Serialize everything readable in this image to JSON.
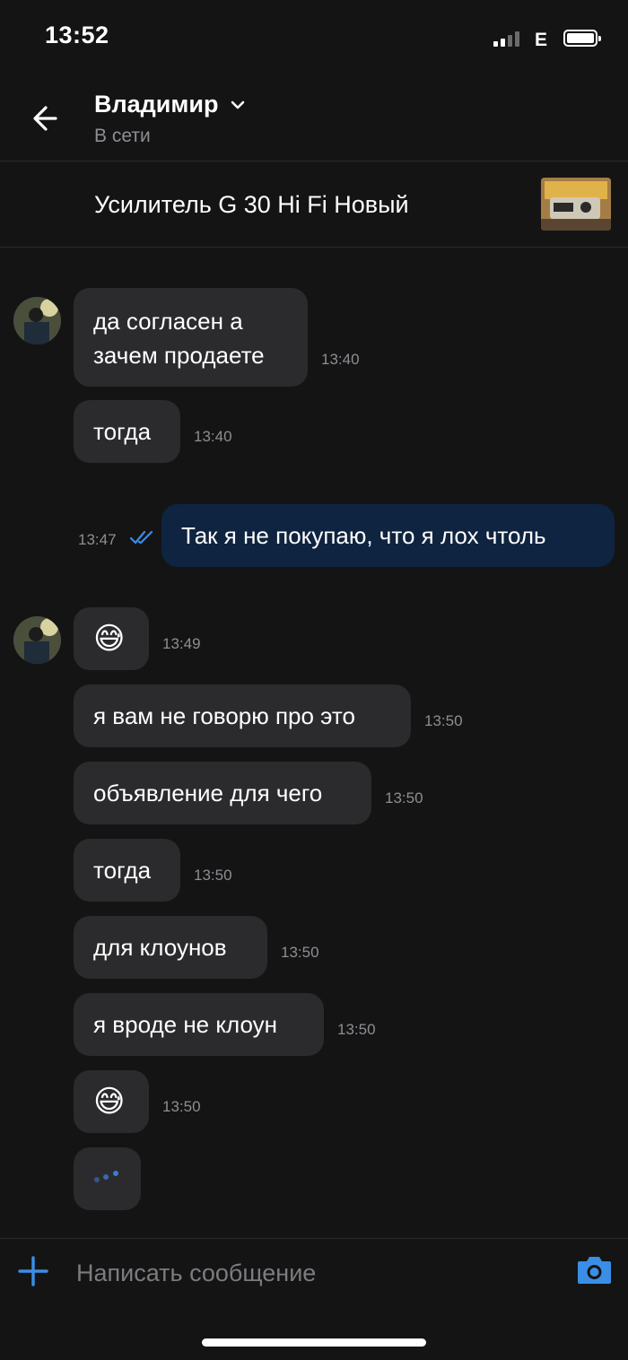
{
  "status_bar": {
    "time": "13:52",
    "network": "E"
  },
  "header": {
    "name": "Владимир",
    "status": "В сети"
  },
  "listing": {
    "title": "Усилитель G 30 Hi Fi Новый"
  },
  "messages": [
    {
      "text": "да согласен а\nзачем продаете",
      "time": "13:40"
    },
    {
      "text": "тогда",
      "time": "13:40"
    },
    {
      "text": "Так я не покупаю, что я лох чтоль",
      "time": "13:47"
    },
    {
      "text": "😅",
      "time": "13:49"
    },
    {
      "text": "я вам не говорю про это",
      "time": "13:50"
    },
    {
      "text": "объявление для чего",
      "time": "13:50"
    },
    {
      "text": "тогда",
      "time": "13:50"
    },
    {
      "text": "для клоунов",
      "time": "13:50"
    },
    {
      "text": "я вроде не клоун",
      "time": "13:50"
    },
    {
      "text": "😅",
      "time": "13:50"
    }
  ],
  "composer": {
    "placeholder": "Написать сообщение"
  },
  "colors": {
    "accent": "#3a8ee6",
    "background": "#141415",
    "incoming_bubble": "#2b2b2d",
    "outgoing_bubble": "#0f2440"
  }
}
